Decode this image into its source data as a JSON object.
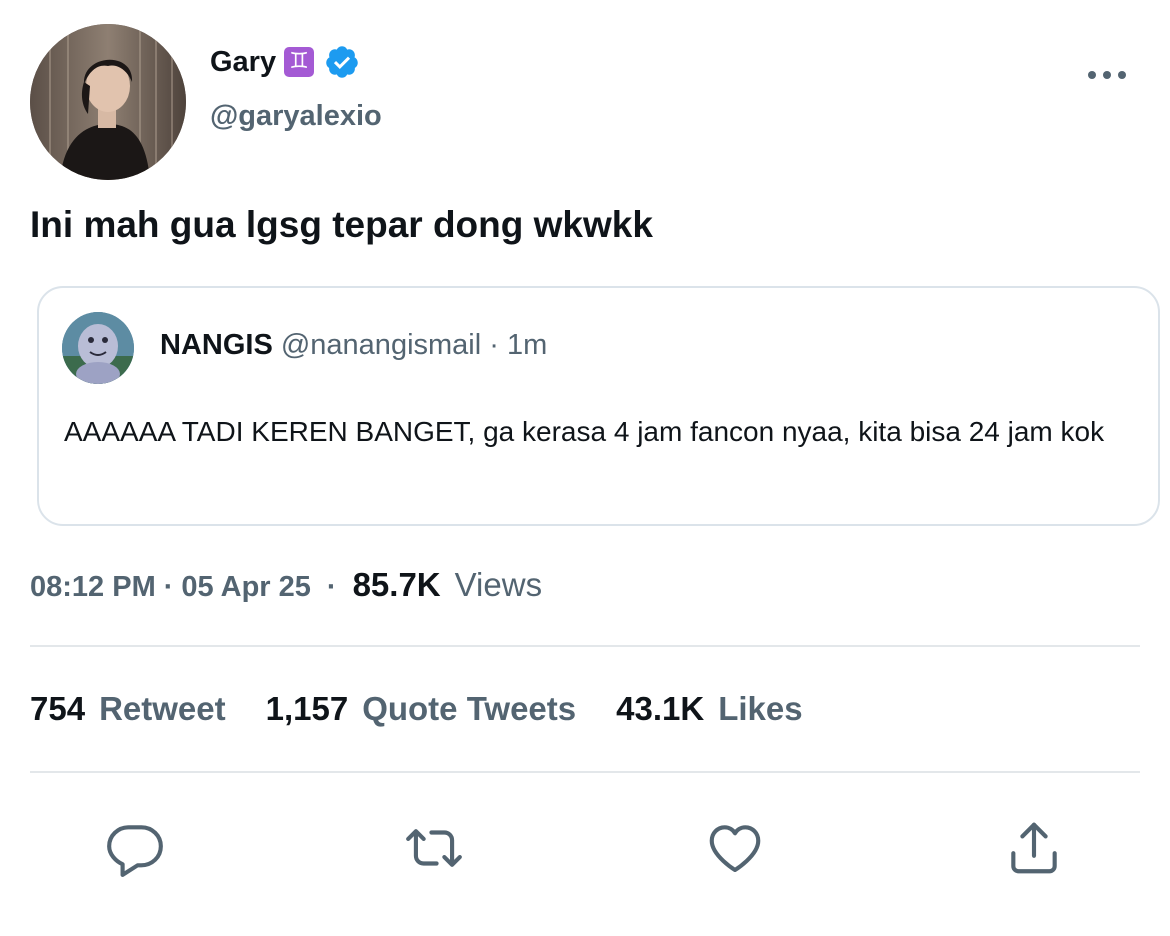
{
  "author": {
    "display_name": "Gary",
    "zodiac_badge": "♊",
    "verified_icon": "verified-badge-icon",
    "handle": "@garyalexio"
  },
  "tweet": {
    "text": "Ini mah gua lgsg tepar dong wkwkk",
    "time": "08:12 PM",
    "dot": "·",
    "date": "05 Apr 25",
    "views_count": "85.7K",
    "views_label": "Views"
  },
  "quoted_tweet": {
    "display_name": "NANGIS",
    "handle": "@nanangismail",
    "separator": "·",
    "time": "1m",
    "text": "AAAAAA TADI KEREN BANGET, ga kerasa 4 jam fancon nyaa, kita bisa 24 jam kok"
  },
  "stats": {
    "retweets_count": "754",
    "retweets_label": "Retweet",
    "quotes_count": "1,157",
    "quotes_label": "Quote Tweets",
    "likes_count": "43.1K",
    "likes_label": "Likes"
  },
  "actions": {
    "reply_icon": "reply-icon",
    "retweet_icon": "retweet-icon",
    "like_icon": "heart-icon",
    "share_icon": "share-icon",
    "more_icon": "more-options-icon"
  },
  "colors": {
    "text_primary": "#0f1419",
    "text_secondary": "#536471",
    "verified_blue": "#1d9bf0",
    "border": "#dbe3ea",
    "divider": "#e3e7ea",
    "zodiac_purple": "#a45ad4"
  }
}
